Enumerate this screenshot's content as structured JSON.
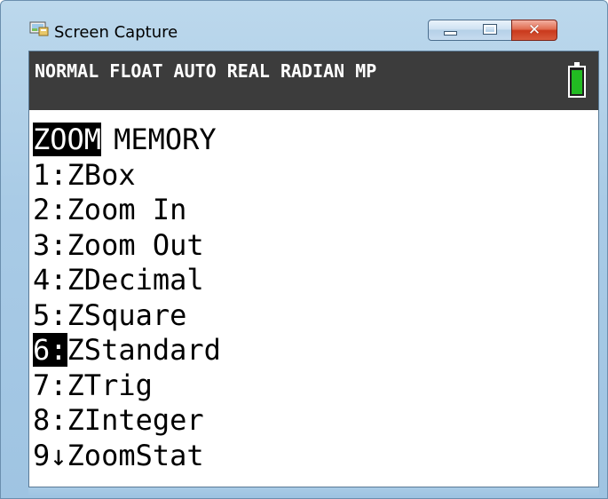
{
  "window": {
    "title": "Screen Capture",
    "controls": {
      "minimize": "minimize",
      "maximize": "maximize",
      "close": "✕"
    }
  },
  "status_bar": {
    "text": "NORMAL FLOAT AUTO REAL RADIAN MP",
    "battery_color": "#22bb22"
  },
  "menu": {
    "tabs": [
      {
        "label": "ZOOM",
        "selected": true
      },
      {
        "label": "MEMORY",
        "selected": false
      }
    ],
    "items": [
      {
        "key": "1:",
        "label": "ZBox"
      },
      {
        "key": "2:",
        "label": "Zoom In"
      },
      {
        "key": "3:",
        "label": "Zoom Out"
      },
      {
        "key": "4:",
        "label": "ZDecimal"
      },
      {
        "key": "5:",
        "label": "ZSquare"
      },
      {
        "key": "6:",
        "label": "ZStandard",
        "highlighted": true
      },
      {
        "key": "7:",
        "label": "ZTrig"
      },
      {
        "key": "8:",
        "label": "ZInteger"
      },
      {
        "key": "9↓",
        "label": "ZoomStat"
      }
    ]
  }
}
